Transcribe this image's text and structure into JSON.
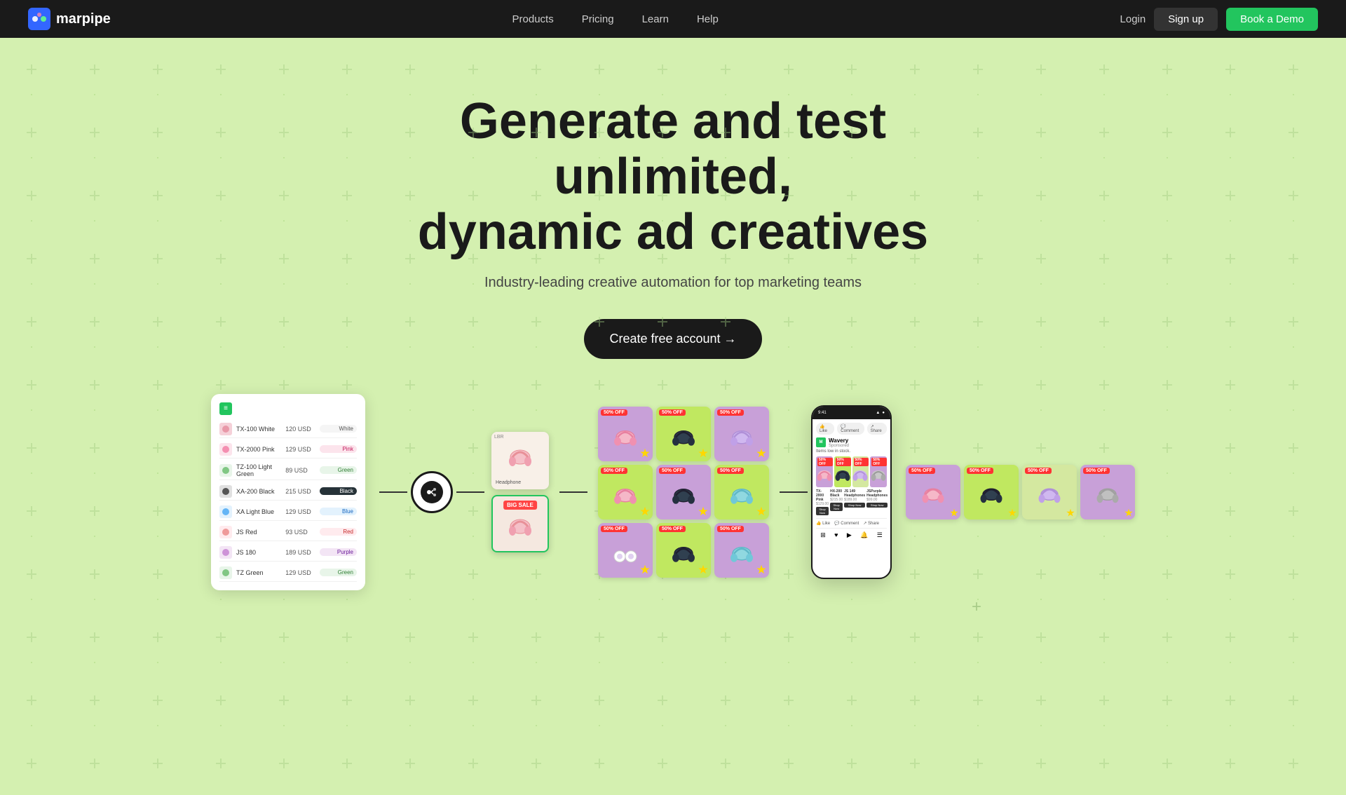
{
  "nav": {
    "logo_text": "marpipe",
    "links": [
      {
        "label": "Products",
        "id": "products"
      },
      {
        "label": "Pricing",
        "id": "pricing"
      },
      {
        "label": "Learn",
        "id": "learn"
      },
      {
        "label": "Help",
        "id": "help"
      }
    ],
    "login_label": "Login",
    "signup_label": "Sign up",
    "demo_label": "Book a Demo"
  },
  "hero": {
    "title_line1": "Generate and test unlimited,",
    "title_line2": "dynamic ad creatives",
    "subtitle": "Industry-leading creative automation for top marketing teams",
    "cta_label": "Create free account →"
  },
  "spreadsheet": {
    "rows": [
      {
        "name": "TX-100 White",
        "price": "120 USD",
        "tag": "White"
      },
      {
        "name": "TX-2000 Pink",
        "price": "129 USD",
        "tag": "Pink"
      },
      {
        "name": "TZ-100 Light Green",
        "price": "89 USD",
        "tag": "Green"
      },
      {
        "name": "XA-200 Black",
        "price": "215 USD",
        "tag": "Black"
      },
      {
        "name": "XA Light Blue",
        "price": "129 USD",
        "tag": "Blue"
      },
      {
        "name": "JS Red",
        "price": "93 USD",
        "tag": "Red"
      },
      {
        "name": "JS 180",
        "price": "189 USD",
        "tag": "Purple"
      },
      {
        "name": "TZ Green",
        "price": "129 USD",
        "tag": "Green"
      }
    ]
  },
  "colors": {
    "nav_bg": "#1a1a1a",
    "hero_bg": "#cceea0",
    "cta_bg": "#1a1a1a",
    "demo_btn_bg": "#22c55e",
    "signup_btn_bg": "#444444"
  }
}
